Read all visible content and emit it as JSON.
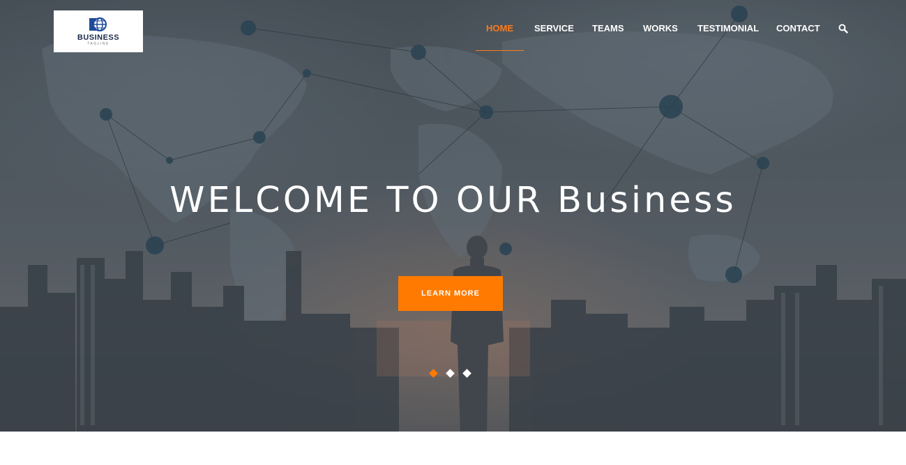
{
  "logo": {
    "name": "BUSINESS",
    "tagline": "TAGLINE"
  },
  "nav": {
    "items": [
      {
        "label": "HOME",
        "active": true
      },
      {
        "label": "SERVICE",
        "active": false
      },
      {
        "label": "TEAMS",
        "active": false
      },
      {
        "label": "WORKS",
        "active": false
      },
      {
        "label": "TESTIMONIAL",
        "active": false
      },
      {
        "label": "CONTACT",
        "active": false
      }
    ],
    "search_icon": "search-icon"
  },
  "hero": {
    "title": "WELCOME TO OUR Business",
    "cta_label": "LEARN MORE",
    "slides": {
      "count": 3,
      "active_index": 1
    }
  },
  "colors": {
    "accent": "#ff7a00",
    "nav_text": "#ffffff",
    "logo_text": "#1e2b4a"
  }
}
